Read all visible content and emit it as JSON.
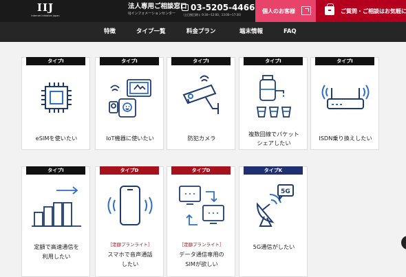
{
  "header": {
    "logo_text": "IIJ",
    "logo_sub": "Internet Initiative Japan",
    "corp_title": "法人専用ご相談窓口",
    "corp_sub": "IIJインフォメーションセンター",
    "phone": "03-5205-4466",
    "hours": "（土日祝日除く 9:30～12:00、13:00～17:30）",
    "personal_button": "個人のお客様",
    "support_button": "ご質問・ご相談はお気軽に"
  },
  "nav": {
    "items": [
      "特徴",
      "タイプ一覧",
      "料金プラン",
      "端末情報",
      "FAQ"
    ]
  },
  "cards": [
    {
      "badge": "タイプI",
      "label": "eSIMを使いたい",
      "tag": "",
      "icon": "chip-icon"
    },
    {
      "badge": "タイプI",
      "label": "IoT機器に使いたい",
      "tag": "",
      "icon": "iot-devices-icon"
    },
    {
      "badge": "タイプI",
      "label": "防犯カメラ",
      "tag": "",
      "icon": "security-camera-icon"
    },
    {
      "badge": "タイプI",
      "label": "複数回線でパケットシェアしたい",
      "label_lines": [
        "複数回線でパケット",
        "シェアしたい"
      ],
      "tag": "",
      "icon": "water-share-icon"
    },
    {
      "badge": "タイプI",
      "label": "ISDN乗り換えしたい",
      "tag": "",
      "icon": "router-icon"
    },
    {
      "badge": "タイプI",
      "label": "定額で高速通信を利用したい",
      "label_lines": [
        "定額で高速通信を",
        "利用したい"
      ],
      "tag": "",
      "icon": "speed-bars-icon"
    },
    {
      "badge": "タイプD",
      "label": "スマホで音声通話したい",
      "label_lines": [
        "スマホで音声通話",
        "したい"
      ],
      "tag": "［定額プランライト］",
      "icon": "smartphone-icon"
    },
    {
      "badge": "タイプD",
      "label": "データ通信専用のSIMが欲しい",
      "label_lines": [
        "データ通信専用の",
        "SIMが欲しい"
      ],
      "tag": "［定額プランライト］",
      "icon": "data-transfer-icon"
    },
    {
      "badge": "タイプK",
      "label": "5G通信がしたい",
      "tag": "",
      "icon": "5g-antenna-icon",
      "icon_text": "5G"
    }
  ],
  "colors": {
    "header_bg": "#1a1a1a",
    "nav_bg": "#262626",
    "personal_pink": "#e8436b",
    "support_red": "#b4001e",
    "badge_black": "#111111",
    "badge_red": "#a5121b",
    "badge_blue": "#1f2f70",
    "icon_navy": "#1d3b6e",
    "icon_blue": "#2f6fbf"
  }
}
